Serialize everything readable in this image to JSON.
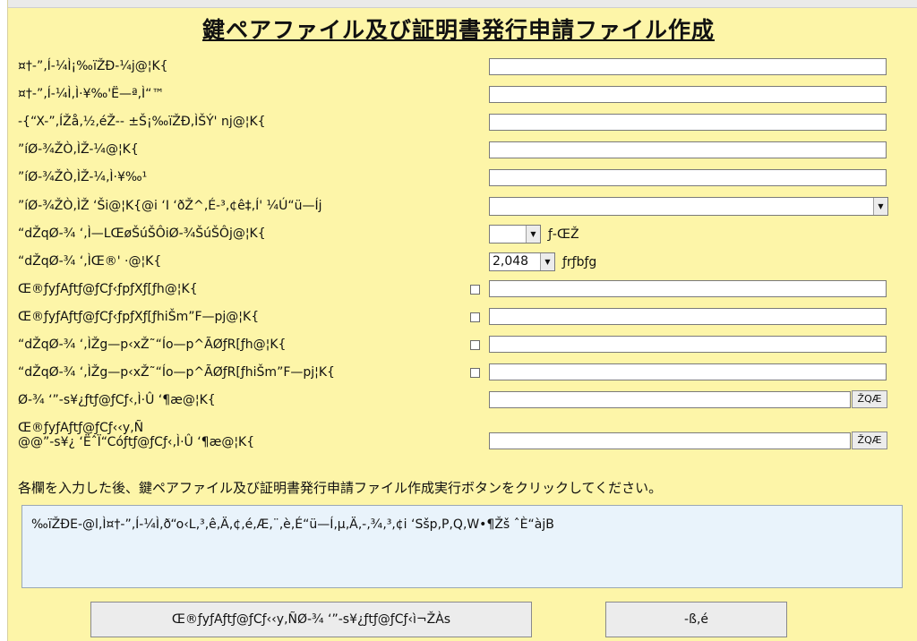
{
  "title": "鍵ペアファイル及び証明書発行申請ファイル作成",
  "rows": [
    {
      "label": "¤†-”‚Í-¼Ì¡‰ïŽÐ-¼j@¦K{"
    },
    {
      "label": "¤†-”‚Í-¼Ì‚Ì·¥‰'Ë—ª‚Ì“™"
    },
    {
      "label": "-{“X-”‚ÍŽå‚½‚éŽ-- ±Š¡‰ïŽÐ‚ÌŠÝ' nj@¦K{"
    },
    {
      "label": "”íØ-¾ŽÒ‚ÌŽ-¼@¦K{"
    },
    {
      "label": "”íØ-¾ŽÒ‚ÌŽ-¼‚Ì·¥‰¹"
    },
    {
      "label": "”íØ-¾ŽÒ‚ÌŽ ‘Ši@¦K{@i ‘I ‘ðŽ^‚É-³‚¢ê‡‚Í' ¼Ú“ü—Íj"
    },
    {
      "label": "“dŽqØ-¾ ‘‚Ì—LŒøŠúŠÔiØ-¾ŠúŠÔj@¦K{",
      "unit": "ƒ-ŒŽ"
    },
    {
      "label": "“dŽqØ-¾ ‘‚ÌŒ®' ·@¦K{",
      "unit": "ƒrƒbƒg",
      "value": "2,048"
    },
    {
      "label": "Œ®ƒyƒAƒtƒ@ƒCƒ‹ƒpƒXƒ[ƒh@¦K{"
    },
    {
      "label": "Œ®ƒyƒAƒtƒ@ƒCƒ‹ƒpƒXƒ[ƒhiŠm”F—pj@¦K{"
    },
    {
      "label": "“dŽqØ-¾ ‘‚ÌŽg—p‹xŽ˜“Íо—p^ÃØƒR[ƒh@¦K{"
    },
    {
      "label": "“dŽqØ-¾ ‘‚ÌŽg—p‹xŽ˜“Íо—p^ÃØƒR[ƒhiŠm”F—pj¦K{"
    },
    {
      "label": "Ø-¾ ‘”-s¥¿ƒtƒ@ƒCƒ‹‚Ì·Û ‘¶æ@¦K{",
      "browse": "ŽQÆ"
    },
    {
      "label_line1": "Œ®ƒyƒAƒtƒ@ƒCƒ‹‹y‚Ñ",
      "label_line2": "@@”-s¥¿ ‘ËˆÏ“Cóƒtƒ@ƒCƒ‹‚Ì·Û ‘¶æ@¦K{",
      "browse": "ŽQÆ"
    }
  ],
  "instruction": "各欄を入力した後、鍵ペアファイル及び証明書発行申請ファイル作成実行ボタンをクリックしてください。",
  "message": "‰ïŽÐE-@l‚Ì¤†-”‚Í-¼Ì‚ð“o‹L‚³‚ê‚Ä‚¢‚é‚Æ‚¨‚è‚É“ü—Í‚µ‚Ä‚-‚¾‚³‚¢i ‘Sšp‚P‚Q‚W•¶Žš ˆÈ“àjB",
  "buttons": {
    "create": "Œ®ƒyƒAƒtƒ@ƒCƒ‹‹y‚ÑØ-¾ ‘”-s¥¿ƒtƒ@ƒCƒ‹ì¬ŽÀs",
    "close": "-ß‚é"
  }
}
